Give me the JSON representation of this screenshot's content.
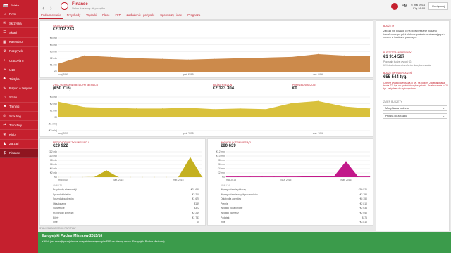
{
  "sidebar": {
    "country": "Polska",
    "items": [
      {
        "icon": "home-icon",
        "glyph": "⌂",
        "label": "Dom",
        "active": false
      },
      {
        "icon": "inbox-icon",
        "glyph": "✉",
        "label": "Skrzynka",
        "active": false
      },
      {
        "icon": "squad-icon",
        "glyph": "☰",
        "label": "Skład",
        "active": false
      },
      {
        "icon": "calendar-icon",
        "glyph": "▦",
        "label": "Kalendarz",
        "active": false
      },
      {
        "icon": "competitions-icon",
        "glyph": "♛",
        "label": "Rozgrywki",
        "active": false
      },
      {
        "icon": "reserves-icon",
        "glyph": "◐",
        "label": "Cracovia II",
        "active": false
      },
      {
        "icon": "u18-icon",
        "glyph": "◑",
        "label": "U18",
        "active": false
      },
      {
        "icon": "tactics-icon",
        "glyph": "✚",
        "label": "Taktyka",
        "active": false
      },
      {
        "icon": "reports-icon",
        "glyph": "✎",
        "label": "Raport o zespole",
        "active": false
      },
      {
        "icon": "staff-icon",
        "glyph": "☺",
        "label": "Sztab",
        "active": false
      },
      {
        "icon": "training-icon",
        "glyph": "⚑",
        "label": "Trening",
        "active": false
      },
      {
        "icon": "scouting-icon",
        "glyph": "◎",
        "label": "Scouting",
        "active": false
      },
      {
        "icon": "transfers-icon",
        "glyph": "⇄",
        "label": "Transfery",
        "active": false
      },
      {
        "icon": "club-icon",
        "glyph": "⛨",
        "label": "Klub",
        "active": false
      },
      {
        "icon": "board-icon",
        "glyph": "♟",
        "label": "Zarząd",
        "active": false
      },
      {
        "icon": "finances-icon",
        "glyph": "$",
        "label": "Finanse",
        "active": true
      }
    ]
  },
  "header": {
    "title": "Finanse",
    "subtitle": "Status finansowy: W porządku",
    "tabs": [
      {
        "label": "Podsumowanie",
        "active": true
      },
      {
        "label": "Przychody",
        "active": false
      },
      {
        "label": "Wydatki",
        "active": false
      },
      {
        "label": "Płace",
        "active": false
      },
      {
        "label": "FFP",
        "active": false
      },
      {
        "label": "Zadłużenie i pożyczki",
        "active": false
      },
      {
        "label": "Sponsorzy i inne",
        "active": false
      },
      {
        "label": "Prognoza",
        "active": false
      }
    ],
    "logo": "FM",
    "date_day": "6 maj 2016",
    "date_time": "Pią 16:00",
    "continue_label": "Kontynuuj"
  },
  "balance": {
    "label": "SALDO CZASOWE",
    "value": "€2 312 233"
  },
  "profit": {
    "label": "ZYSK / STRATA W BIEŻĄCYM MIESIĄCU",
    "value": "(€50 716)",
    "current_label": "BIEŻĄCY SEZON",
    "current_value": "€2 123 304",
    "prev_label": "POPRZEDNI SEZON",
    "prev_value": "€0"
  },
  "income": {
    "label": "PRZYCHODY W TYM MIESIĄCU",
    "value": "€29 922",
    "analysis_title": "ANALIZA",
    "rows": [
      {
        "name": "Przychody z transmisji",
        "value": "€21 650"
      },
      {
        "name": "Sprzedaż biletów",
        "value": "€2 210"
      },
      {
        "name": "Sprzedaż gadżetów",
        "value": "€1 670"
      },
      {
        "name": "Okazjonalne",
        "value": "€149"
      },
      {
        "name": "Subwencje",
        "value": "€372"
      },
      {
        "name": "Przychody z meczu",
        "value": "€2 219"
      },
      {
        "name": "Bilety",
        "value": "€1 733"
      },
      {
        "name": "Inne",
        "value": "€0"
      }
    ]
  },
  "expenses": {
    "label": "WYDATKI W TYM MIESIĄCU",
    "value": "€80 639",
    "analysis_title": "ANALIZA",
    "rows": [
      {
        "name": "Wynagrodzenia piłkarzy",
        "value": "€59 521"
      },
      {
        "name": "Wynagrodzenia współpracowników",
        "value": "€2 796"
      },
      {
        "name": "Opłaty dla agentów",
        "value": "€6 350"
      },
      {
        "name": "Premie",
        "value": "€2 810"
      },
      {
        "name": "Wydatki pozaporowe",
        "value": "€2 636"
      },
      {
        "name": "Wydatki na mecz",
        "value": "€2 040"
      },
      {
        "name": "Podatek",
        "value": "€476"
      },
      {
        "name": "Inne",
        "value": "€3 810"
      }
    ]
  },
  "chart_data": [
    {
      "type": "area",
      "title": "SALDO CZASOWE",
      "x": [
        "maj 2015",
        "",
        "",
        "",
        "",
        "paź. 2015",
        "",
        "",
        "",
        "",
        "mar. 2016",
        "",
        ""
      ],
      "values": [
        1.2,
        2.4,
        2.2,
        2.0,
        1.9,
        1.8,
        1.9,
        2.0,
        2.1,
        2.2,
        2.6,
        2.4,
        2.3
      ],
      "yticks": [
        "€5 mln",
        "€4 mln",
        "€3 mln",
        "€2 mln",
        "€1 mln",
        "€0"
      ],
      "ylim": [
        0,
        5
      ],
      "xticks": [
        "maj 2015",
        "paź. 2015",
        "mar. 2016"
      ],
      "color": "#cc8a4b"
    },
    {
      "type": "area",
      "title": "ZYSK / STRATA W BIEŻĄCYM MIESIĄCU",
      "values": [
        2.3,
        1.5,
        1.4,
        1.3,
        1.3,
        1.4,
        1.2,
        1.3,
        1.2,
        2.1,
        2.4,
        1.6,
        1.3
      ],
      "yticks": [
        "€3 mln",
        "€2 mln",
        "€1 mln",
        "€0",
        "(€1 mln)",
        "(€2 mln)"
      ],
      "ylim": [
        -2,
        3
      ],
      "xticks": [
        "maj 2015",
        "paź. 2015",
        "mar. 2016"
      ],
      "color": "#d9c13c"
    },
    {
      "type": "area",
      "title": "PRZYCHODY W TYM MIESIĄCU",
      "values": [
        0,
        0,
        0,
        0.1,
        3.2,
        0,
        0,
        0,
        0,
        0,
        0,
        9.5,
        0
      ],
      "yticks": [
        "€12 mln",
        "€10 mln",
        "€8 mln",
        "€6 mln",
        "€4 mln",
        "€2 mln",
        "€0"
      ],
      "ylim": [
        0,
        12
      ],
      "xticks": [
        "maj 2015",
        "paź. 2015",
        "mar. 2016"
      ],
      "color": "#c4b020"
    },
    {
      "type": "area",
      "title": "WYDATKI W TYM MIESIĄCU",
      "values": [
        0.3,
        0.3,
        0.3,
        0.3,
        0.3,
        0.3,
        0.3,
        0.4,
        0.4,
        0.4,
        7.5,
        0.3,
        0.3
      ],
      "yticks": [
        "€12 mln",
        "€10 mln",
        "€8 mln",
        "€6 mln",
        "€4 mln",
        "€2 mln",
        "€0"
      ],
      "ylim": [
        0,
        12
      ],
      "xticks": [
        "maj 2015",
        "paź. 2015",
        "mar. 2016"
      ],
      "color": "#c2188a"
    }
  ],
  "rightpanel": {
    "budgets_label": "BUDŻETY",
    "budgets_text": "Zarząd nie pozwoli ci na podwyższanie budżetu transferowego, gdyż klub nie posiada wystarczających rezerw w funduszu płacowym.",
    "transfer_label": "BUDŻET TRANSFEROWY",
    "transfer_value": "€1 914 567",
    "transfer_remaining": "Pozostały budżet wynosi €0.",
    "transfer_note": "65% dochodowa z transferów do wykorzystania",
    "wage_label": "BUDŻET WYNAGRODZEŃ",
    "wage_value": "€55 544 tyg.",
    "wage_alert": "Obecne wydatki wynoszą €72 tys. na tydzień. Zadeklarowana kwota €71 tys. na tydzień do wykorzystania. Przekroczenie o €16 tys. na tydzień do wykorzystania.",
    "change_label": "ZMIEŃ BUDŻETY",
    "select_1": "Modyfikacja budżetu",
    "select_2": "Prośba do zarządu"
  },
  "fairplay_label": "STAN FINANSOWEGO FAIR PLAY",
  "banner": {
    "title": "Europejski Puchar Mistrzów 2015/16",
    "text": "Klub jest na najlepszej drodze do spełnienia wymogów FFP na obecny sezon (Europejski Puchar Mistrzów)."
  }
}
